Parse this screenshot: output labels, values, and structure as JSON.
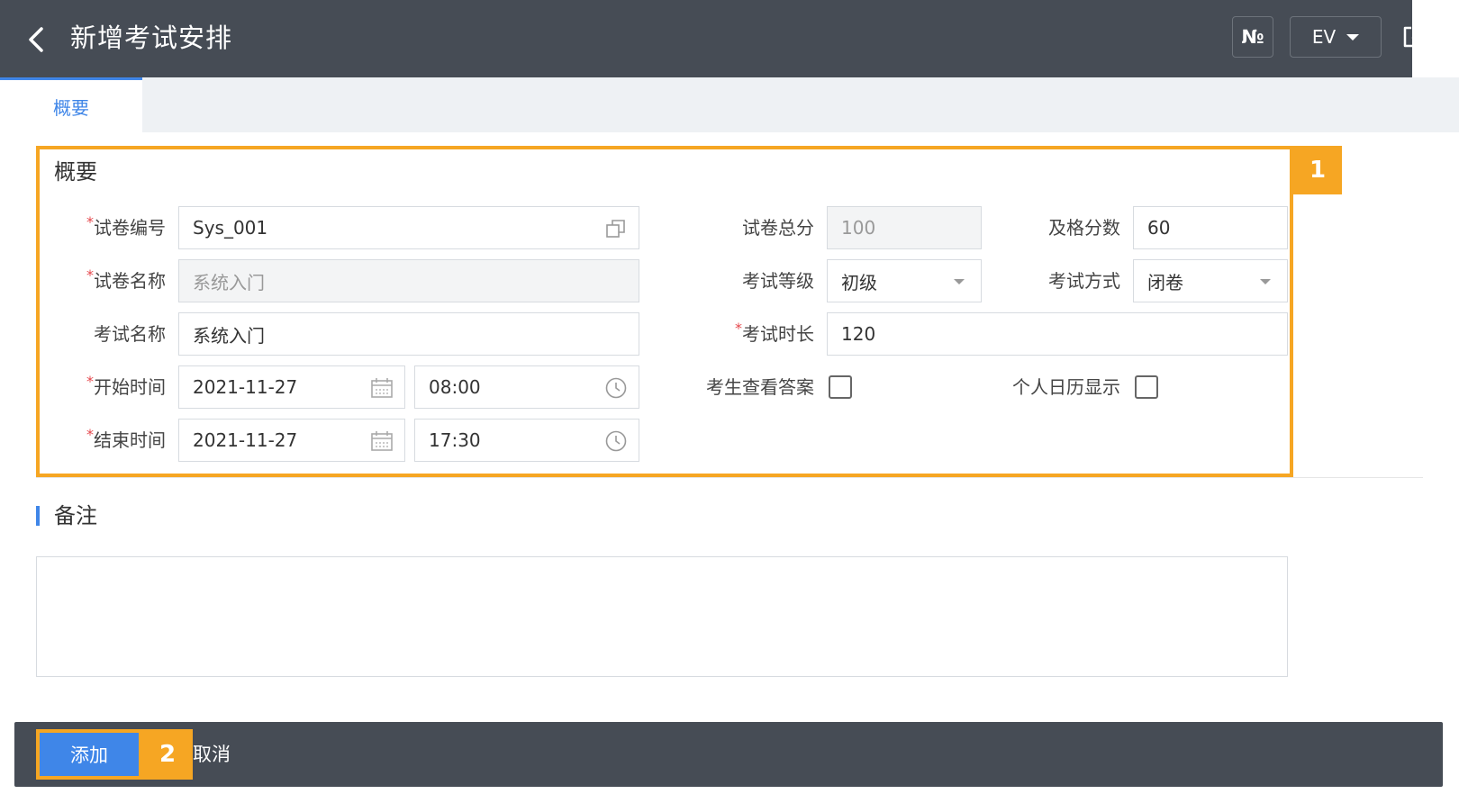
{
  "header": {
    "title": "新增考试安排",
    "no_label": "№",
    "lang_label": "EV"
  },
  "tabs": [
    {
      "label": "概要"
    }
  ],
  "overview": {
    "section_title": "概要",
    "paper_code": {
      "label": "试卷编号",
      "value": "Sys_001"
    },
    "paper_name": {
      "label": "试卷名称",
      "value": "系统入门"
    },
    "exam_name": {
      "label": "考试名称",
      "value": "系统入门"
    },
    "start_time": {
      "label": "开始时间",
      "date": "2021-11-27",
      "time": "08:00"
    },
    "end_time": {
      "label": "结束时间",
      "date": "2021-11-27",
      "time": "17:30"
    },
    "total_score": {
      "label": "试卷总分",
      "value": "100"
    },
    "pass_score": {
      "label": "及格分数",
      "value": "60"
    },
    "exam_level": {
      "label": "考试等级",
      "value": "初级"
    },
    "exam_mode": {
      "label": "考试方式",
      "value": "闭卷"
    },
    "duration": {
      "label": "考试时长",
      "value": "120"
    },
    "view_answers": {
      "label": "考生查看答案",
      "checked": false
    },
    "calendar_display": {
      "label": "个人日历显示",
      "checked": false
    }
  },
  "remarks": {
    "section_title": "备注",
    "value": ""
  },
  "footer": {
    "add_label": "添加",
    "cancel_label": "取消"
  },
  "annotations": {
    "badge1": "1",
    "badge2": "2"
  },
  "colors": {
    "header_bg": "#464c55",
    "accent": "#3f86e8",
    "highlight": "#f6a623",
    "required": "#e5484d"
  }
}
